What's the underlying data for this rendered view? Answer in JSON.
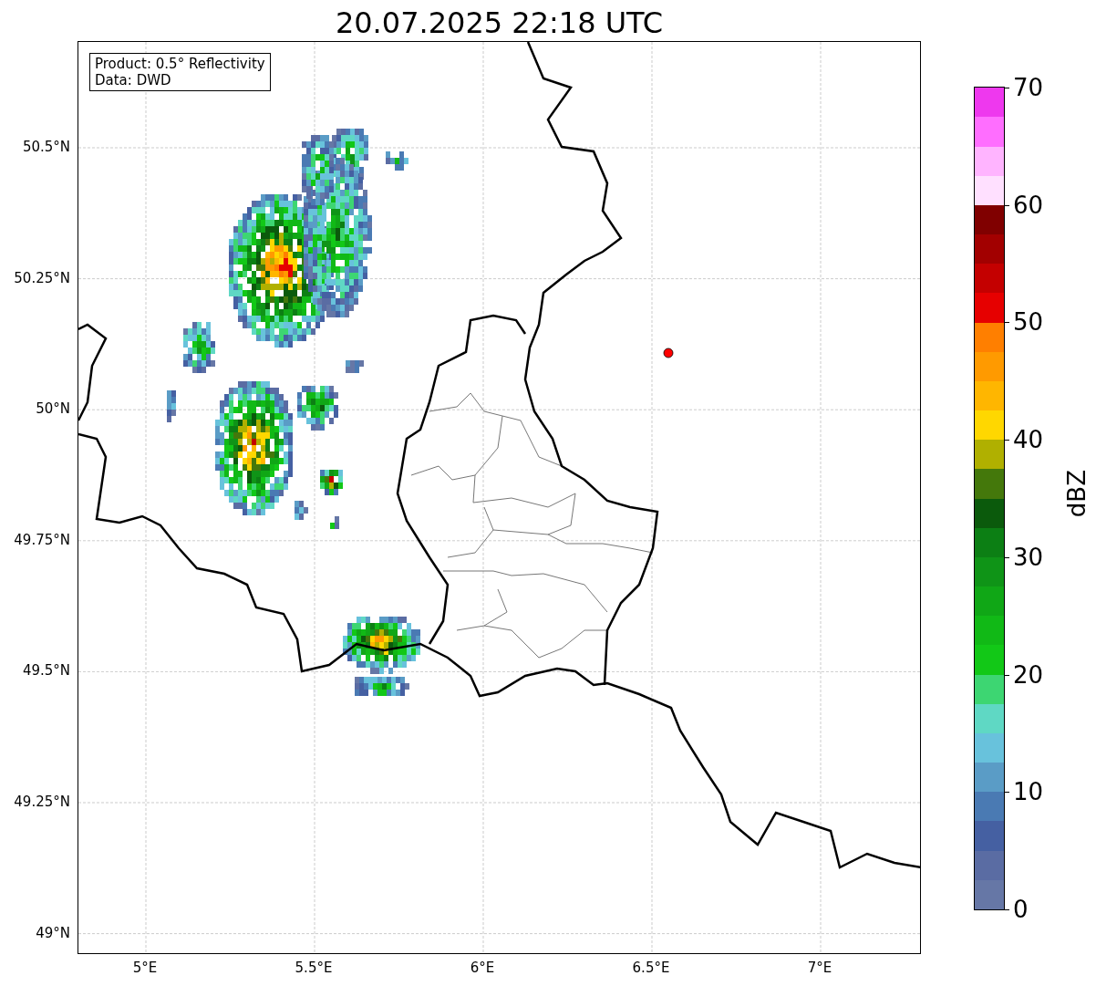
{
  "title": "20.07.2025 22:18 UTC",
  "info_box": [
    "Product: 0.5° Reflectivity",
    "Data: DWD"
  ],
  "map": {
    "x_ticks": [
      "5°E",
      "5.5°E",
      "6°E",
      "6.5°E",
      "7°E"
    ],
    "y_ticks": [
      "50.5°N",
      "50.25°N",
      "50°N",
      "49.75°N",
      "49.5°N",
      "49.25°N",
      "49°N"
    ]
  },
  "colorbar": {
    "label": "dBZ",
    "ticks": [
      "70",
      "60",
      "50",
      "40",
      "30",
      "20",
      "10",
      "0"
    ],
    "segments": [
      {
        "color": "#6677a6"
      },
      {
        "color": "#5a6ca3"
      },
      {
        "color": "#4560a2"
      },
      {
        "color": "#4a7ab3"
      },
      {
        "color": "#5a9cc6"
      },
      {
        "color": "#68c2dc"
      },
      {
        "color": "#5fd8c4"
      },
      {
        "color": "#3dd672"
      },
      {
        "color": "#12c817"
      },
      {
        "color": "#11b916"
      },
      {
        "color": "#10a716"
      },
      {
        "color": "#0f9417"
      },
      {
        "color": "#0c7f14"
      },
      {
        "color": "#0b5a0c"
      },
      {
        "color": "#44780b"
      },
      {
        "color": "#b0b000"
      },
      {
        "color": "#ffd700"
      },
      {
        "color": "#ffb600"
      },
      {
        "color": "#ff9a00"
      },
      {
        "color": "#ff7f00"
      },
      {
        "color": "#e60000"
      },
      {
        "color": "#c40000"
      },
      {
        "color": "#a20000"
      },
      {
        "color": "#800000"
      },
      {
        "color": "#ffe0ff"
      },
      {
        "color": "#ffb4ff"
      },
      {
        "color": "#ff6eff"
      },
      {
        "color": "#ee38ee"
      }
    ]
  }
}
